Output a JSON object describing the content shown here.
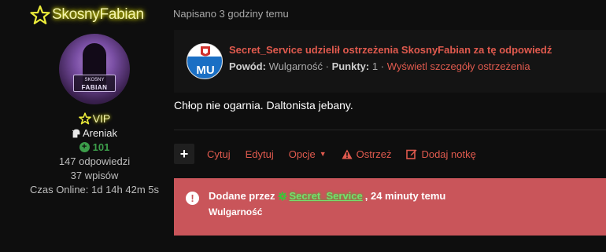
{
  "author": {
    "username": "SkosnyFabian",
    "avatar": {
      "plate_top": "SKOSNY",
      "plate_bottom": "FABIAN"
    },
    "rank": "VIP",
    "group": "Areniak",
    "reputation": "101",
    "posts": "147 odpowiedzi",
    "topics": "37 wpisów",
    "online_time": "Czas Online: 1d 14h 42m 5s",
    "colors": {
      "name_glow": "#e6e600",
      "rep": "#3c9d4a"
    }
  },
  "post": {
    "date": "Napisano 3 godziny temu",
    "warning": {
      "emblem": "MU",
      "title": "Secret_Service udzielił ostrzeżenia SkosnyFabian za tę odpowiedź",
      "reason_label": "Powód:",
      "reason": "Wulgarność",
      "sep1": "·",
      "points_label": "Punkty:",
      "points": "1",
      "sep2": "·",
      "details_link": "Wyświetl szczegóły ostrzeżenia"
    },
    "content": "Chłop nie ogarnia. Daltonista jebany."
  },
  "actions": {
    "plus": "+",
    "quote": "Cytuj",
    "edit": "Edytuj",
    "options": "Opcje",
    "warn": "Ostrzeż",
    "note": "Dodaj notkę"
  },
  "moderator_note": {
    "prefix": "Dodane przez",
    "moderator": "Secret_Service",
    "suffix": ", 24 minuty temu",
    "text": "Wulgarność",
    "colors": {
      "background": "#c9555a",
      "moderator": "#76e06d"
    }
  },
  "colors": {
    "accent": "#e05a4e",
    "background": "#0e0e0e"
  }
}
